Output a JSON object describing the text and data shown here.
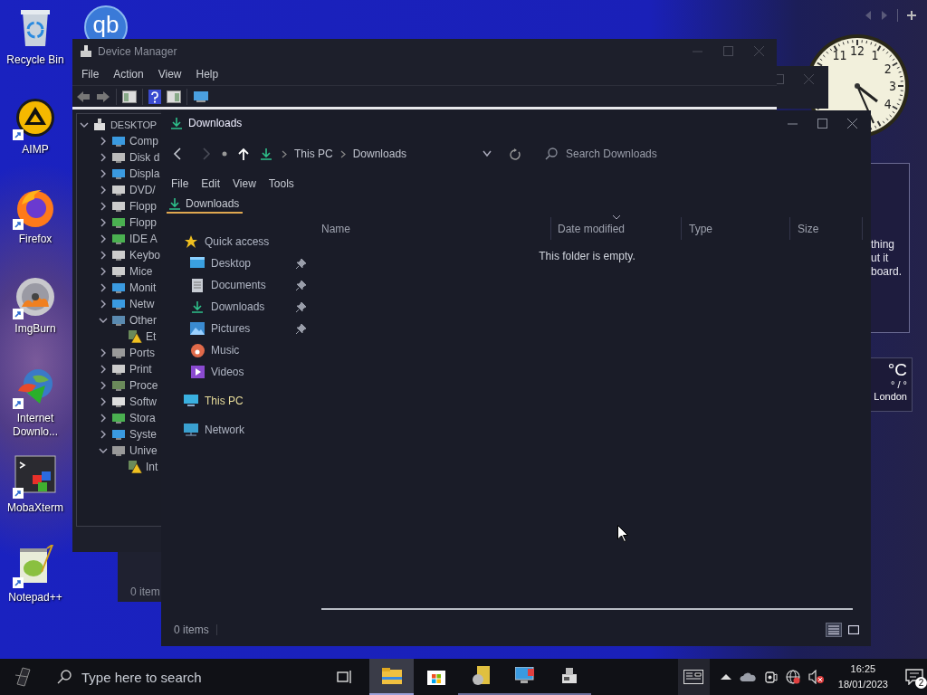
{
  "desktop": {
    "logo_badge": {
      "text": "qb"
    },
    "icons": [
      {
        "label": "Recycle Bin",
        "shortcut": false
      },
      {
        "label": "AIMP",
        "shortcut": true
      },
      {
        "label": "Firefox",
        "shortcut": true
      },
      {
        "label": "ImgBurn",
        "shortcut": true
      },
      {
        "label": "Internet Downlo...",
        "shortcut": true
      },
      {
        "label": "MobaXterm",
        "shortcut": true
      },
      {
        "label": "Notepad++",
        "shortcut": true
      }
    ]
  },
  "gadgets": {
    "clock": {
      "numerals": [
        "11",
        "12",
        "1",
        "2",
        "3",
        "4"
      ]
    },
    "note": {
      "lines": [
        "thing",
        "ut it",
        "board."
      ]
    },
    "weather": {
      "unit": "°C",
      "range": "° / °",
      "city": "London"
    }
  },
  "device_manager": {
    "title": "Device Manager",
    "menu": [
      "File",
      "Action",
      "View",
      "Help"
    ],
    "tree": {
      "label": "DESKTOP",
      "expanded": true,
      "children": [
        {
          "label": "Comp",
          "expanded": false
        },
        {
          "label": "Disk d",
          "expanded": false
        },
        {
          "label": "Displa",
          "expanded": false
        },
        {
          "label": "DVD/",
          "expanded": false
        },
        {
          "label": "Flopp",
          "expanded": false
        },
        {
          "label": "Flopp",
          "expanded": false
        },
        {
          "label": "IDE A",
          "expanded": false
        },
        {
          "label": "Keybo",
          "expanded": false
        },
        {
          "label": "Mice",
          "expanded": false
        },
        {
          "label": "Monit",
          "expanded": false
        },
        {
          "label": "Netw",
          "expanded": false
        },
        {
          "label": "Other",
          "expanded": true,
          "children": [
            {
              "label": "Et",
              "warning": true
            }
          ]
        },
        {
          "label": "Ports",
          "expanded": false
        },
        {
          "label": "Print",
          "expanded": false
        },
        {
          "label": "Proce",
          "expanded": false
        },
        {
          "label": "Softw",
          "expanded": false
        },
        {
          "label": "Stora",
          "expanded": false
        },
        {
          "label": "Syste",
          "expanded": false
        },
        {
          "label": "Unive",
          "expanded": true,
          "children": [
            {
              "label": "Int",
              "warning": true
            }
          ]
        }
      ]
    }
  },
  "background_window": {
    "status": "0 item"
  },
  "explorer": {
    "title": "Downloads",
    "breadcrumb": [
      "This PC",
      "Downloads"
    ],
    "search": {
      "placeholder": "Search Downloads"
    },
    "menu": [
      "File",
      "Edit",
      "View",
      "Tools"
    ],
    "tabs": [
      {
        "label": "Downloads",
        "selected": true
      }
    ],
    "nav": [
      {
        "label": "Quick access",
        "kind": "star",
        "selected": false,
        "children": [
          {
            "label": "Desktop",
            "kind": "desktop",
            "pinned": true,
            "selected": false
          },
          {
            "label": "Documents",
            "kind": "documents",
            "pinned": true,
            "selected": false
          },
          {
            "label": "Downloads",
            "kind": "downloads",
            "pinned": true,
            "selected": false
          },
          {
            "label": "Pictures",
            "kind": "pictures",
            "pinned": true,
            "selected": false
          },
          {
            "label": "Music",
            "kind": "music",
            "pinned": false,
            "selected": false
          },
          {
            "label": "Videos",
            "kind": "videos",
            "pinned": false,
            "selected": false
          }
        ]
      },
      {
        "label": "This PC",
        "kind": "computer",
        "selected": true
      },
      {
        "label": "Network",
        "kind": "network",
        "selected": false
      }
    ],
    "columns": [
      {
        "label": "Name",
        "sorted": false
      },
      {
        "label": "Date modified",
        "sorted": true
      },
      {
        "label": "Type",
        "sorted": false
      },
      {
        "label": "Size",
        "sorted": false
      }
    ],
    "empty_message": "This folder is empty.",
    "status": "0 items",
    "views": [
      {
        "selected": true
      },
      {
        "selected": false
      }
    ]
  },
  "taskbar": {
    "search": {
      "placeholder": "Type here to search"
    },
    "apps": [
      {
        "active": true,
        "running": true
      },
      {
        "active": false,
        "running": false
      },
      {
        "active": false,
        "running": true
      },
      {
        "active": false,
        "running": true
      },
      {
        "active": false,
        "running": true
      }
    ],
    "time": "16:25",
    "date": "18/01/2023",
    "notifications": "2"
  }
}
